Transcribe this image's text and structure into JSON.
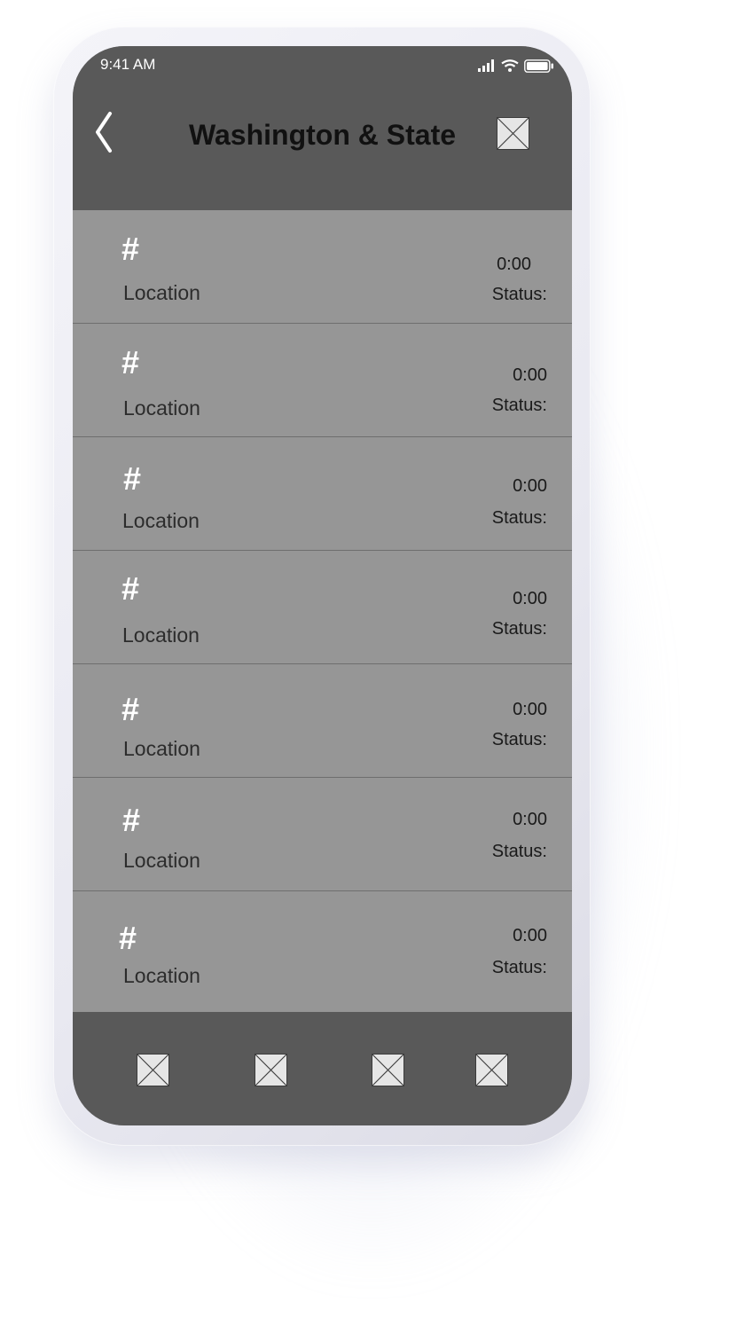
{
  "status_bar": {
    "time": "9:41 AM"
  },
  "header": {
    "title": "Washington & State",
    "back_icon": "chevron-left-icon",
    "action_icon": "image-placeholder-icon"
  },
  "rows": [
    {
      "number": "#",
      "location": "Location",
      "time": "0:00",
      "status": "Status:"
    },
    {
      "number": "#",
      "location": "Location",
      "time": "0:00",
      "status": "Status:"
    },
    {
      "number": "#",
      "location": "Location",
      "time": "0:00",
      "status": "Status:"
    },
    {
      "number": "#",
      "location": "Location",
      "time": "0:00",
      "status": "Status:"
    },
    {
      "number": "#",
      "location": "Location",
      "time": "0:00",
      "status": "Status:"
    },
    {
      "number": "#",
      "location": "Location",
      "time": "0:00",
      "status": "Status:"
    },
    {
      "number": "#",
      "location": "Location",
      "time": "0:00",
      "status": "Status:"
    }
  ],
  "tab_bar": {
    "icons": [
      "image-placeholder-icon",
      "image-placeholder-icon",
      "image-placeholder-icon",
      "image-placeholder-icon"
    ]
  },
  "colors": {
    "header_bg": "#595959",
    "list_bg": "#969696",
    "divider": "#6e6e6e"
  }
}
